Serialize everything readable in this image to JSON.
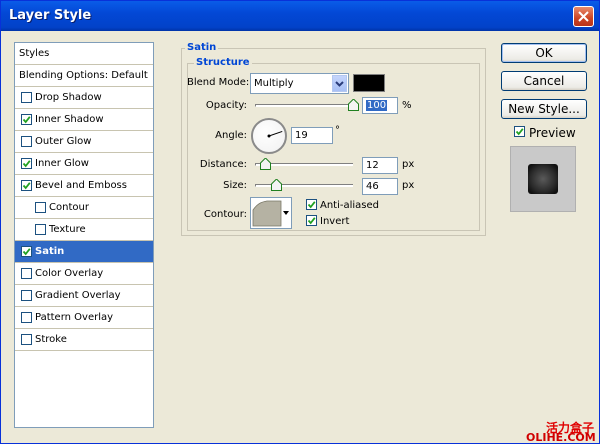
{
  "window": {
    "title": "Layer Style"
  },
  "styles_panel": {
    "items": [
      {
        "label": "Styles",
        "checkbox": false,
        "checked": false,
        "indent": 0
      },
      {
        "label": "Blending Options: Default",
        "checkbox": false,
        "checked": false,
        "indent": 0
      },
      {
        "label": "Drop Shadow",
        "checkbox": true,
        "checked": false,
        "indent": 0
      },
      {
        "label": "Inner Shadow",
        "checkbox": true,
        "checked": true,
        "indent": 0
      },
      {
        "label": "Outer Glow",
        "checkbox": true,
        "checked": false,
        "indent": 0
      },
      {
        "label": "Inner Glow",
        "checkbox": true,
        "checked": true,
        "indent": 0
      },
      {
        "label": "Bevel and Emboss",
        "checkbox": true,
        "checked": true,
        "indent": 0
      },
      {
        "label": "Contour",
        "checkbox": true,
        "checked": false,
        "indent": 1
      },
      {
        "label": "Texture",
        "checkbox": true,
        "checked": false,
        "indent": 1
      },
      {
        "label": "Satin",
        "checkbox": true,
        "checked": true,
        "indent": 0,
        "selected": true
      },
      {
        "label": "Color Overlay",
        "checkbox": true,
        "checked": false,
        "indent": 0
      },
      {
        "label": "Gradient Overlay",
        "checkbox": true,
        "checked": false,
        "indent": 0
      },
      {
        "label": "Pattern Overlay",
        "checkbox": true,
        "checked": false,
        "indent": 0
      },
      {
        "label": "Stroke",
        "checkbox": true,
        "checked": false,
        "indent": 0
      }
    ]
  },
  "satin": {
    "group_title": "Satin",
    "structure_title": "Structure",
    "blend_mode_label": "Blend Mode:",
    "blend_mode_value": "Multiply",
    "color": "#000000",
    "opacity_label": "Opacity:",
    "opacity_value": "100",
    "opacity_unit": "%",
    "opacity_level": 1.0,
    "angle_label": "Angle:",
    "angle_value": "19",
    "angle_unit": "°",
    "distance_label": "Distance:",
    "distance_value": "12",
    "distance_unit": "px",
    "distance_level": 0.06,
    "size_label": "Size:",
    "size_value": "46",
    "size_unit": "px",
    "size_level": 0.18,
    "contour_label": "Contour:",
    "anti_aliased_label": "Anti-aliased",
    "anti_aliased_checked": true,
    "invert_label": "Invert",
    "invert_checked": true
  },
  "buttons": {
    "ok": "OK",
    "cancel": "Cancel",
    "new_style": "New Style..."
  },
  "preview": {
    "label": "Preview",
    "checked": true
  },
  "watermark": {
    "line1": "活力盒子",
    "line2": "OLIHE.COM"
  },
  "colors": {
    "accent": "#316ac5",
    "title_bar": "#0348d6",
    "group_title": "#0046d5"
  }
}
